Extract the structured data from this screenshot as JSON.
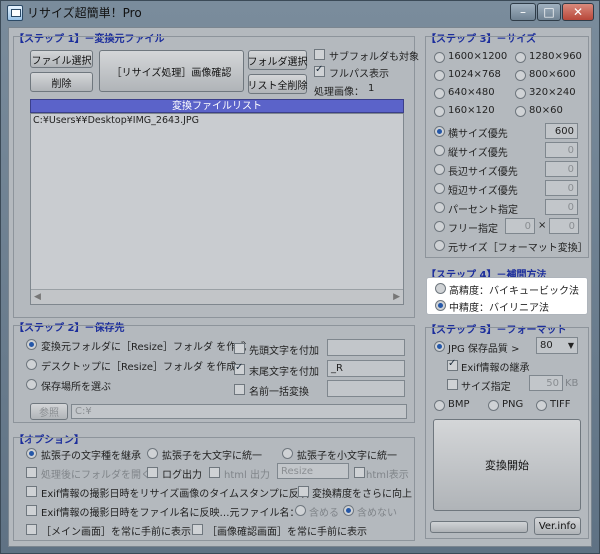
{
  "window": {
    "title": "リサイズ超簡単！Pro",
    "minimize": "–",
    "maximize": "□",
    "close": "✕"
  },
  "step1": {
    "title": "【ステップ 1】－変換元ファイル",
    "file_select": "ファイル選択",
    "delete": "削除",
    "resize_preview": "［リサイズ処理］画像確認",
    "folder_select": "フォルダ選択",
    "list_clear": "リスト全削除",
    "subfolder_label": "サブフォルダも対象",
    "subfolder_checked": false,
    "fullpath_label": "フルパス表示",
    "fullpath_checked": true,
    "processed_label": "処理画像：",
    "processed_count": "1",
    "list_header": "変換ファイルリスト",
    "files": [
      "C:¥Users¥¥Desktop¥IMG_2643.JPG"
    ]
  },
  "step2": {
    "title": "【ステップ 2】－保存先",
    "options": [
      {
        "label": "変換元フォルダに［Resize］フォルダ を作成",
        "selected": true
      },
      {
        "label": "デスクトップに［Resize］フォルダ を作成",
        "selected": false
      },
      {
        "label": "保存場所を選ぶ",
        "selected": false
      }
    ],
    "browse": "参照",
    "path": "C:¥",
    "prefix_label": "先頭文字を付加",
    "prefix_checked": false,
    "prefix_value": "",
    "suffix_label": "末尾文字を付加",
    "suffix_checked": true,
    "suffix_value": "_R",
    "rename_label": "名前一括変換",
    "rename_checked": false,
    "rename_value": ""
  },
  "options": {
    "title": "【オプション】",
    "ext_keep": "拡張子の文字種を継承",
    "ext_upper": "拡張子を大文字に統一",
    "ext_lower": "拡張子を小文字に統一",
    "open_folder": "処理後にフォルダを開く",
    "log_output": "ログ出力",
    "html_output": "html 出力",
    "html_folder": "Resize",
    "html_display": "html表示",
    "exif_timestamp": "Exif情報の撮影日時をリサイズ画像のタイムスタンプに反映",
    "precision_up": "変換精度をさらに向上",
    "exif_filename": "Exif情報の撮影日時をファイル名に反映…元ファイル名：",
    "include": "含める",
    "exclude": "含めない",
    "main_front": "［メイン画面］を常に手前に表示",
    "preview_front": "［画像確認画面］を常に手前に表示"
  },
  "step3": {
    "title": "【ステップ 3】－サイズ",
    "presets": [
      "1600×1200",
      "1280×960",
      "1024×768",
      "800×600",
      "640×480",
      "320×240",
      "160×120",
      "80×60"
    ],
    "width_priority": "横サイズ優先",
    "width_value": "600",
    "height_priority": "縦サイズ優先",
    "height_value": "0",
    "long_priority": "長辺サイズ優先",
    "long_value": "0",
    "short_priority": "短辺サイズ優先",
    "short_value": "0",
    "percent": "パーセント指定",
    "percent_value": "0",
    "free": "フリー指定",
    "free_w": "0",
    "free_x": "×",
    "free_h": "0",
    "original": "元サイズ［フォーマット変換］"
  },
  "step4": {
    "title": "【ステップ 4】－補間方法",
    "high": "高精度：バイキュービック法",
    "mid": "中精度：バイリニア法"
  },
  "step5": {
    "title": "【ステップ 5】－フォーマット",
    "jpg_label": "JPG 保存品質 >",
    "jpg_quality": "80",
    "exif_keep": "Exif情報の継承",
    "size_spec": "サイズ指定",
    "size_value": "50",
    "size_unit": "KB",
    "bmp": "BMP",
    "png": "PNG",
    "tiff": "TIFF",
    "start": "変換開始",
    "version": "Ver.info"
  }
}
